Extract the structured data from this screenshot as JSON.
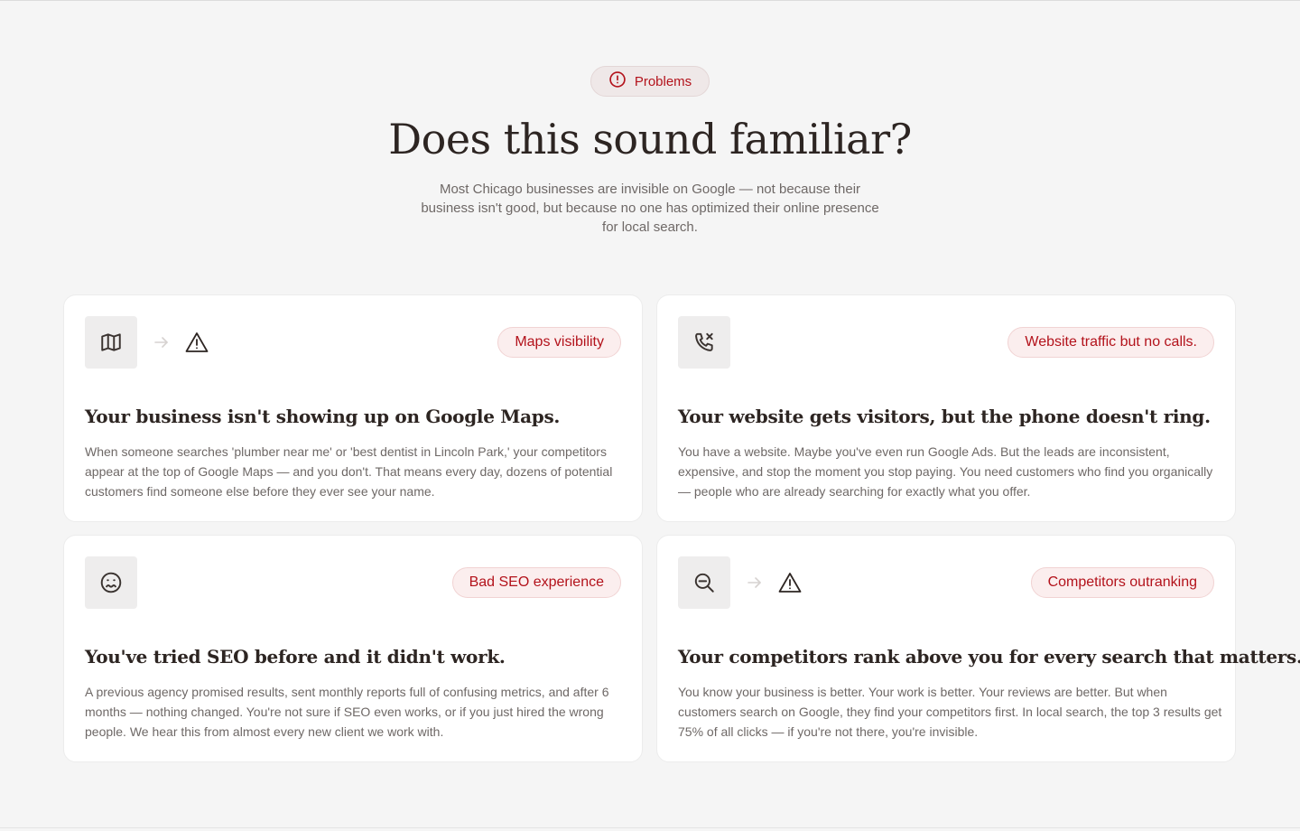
{
  "header": {
    "badge_label": "Problems",
    "badge_icon": "alert-circle-icon",
    "title": "Does this sound familiar?",
    "subtitle": "Most Chicago businesses are invisible on Google — not because their business isn't good, but because no one has optimized their online presence for local search."
  },
  "colors": {
    "accent": "#b3121b",
    "background": "#f5f5f5",
    "card": "#ffffff",
    "tag_background": "#fbeeee"
  },
  "cards": [
    {
      "icon": "map-icon",
      "tag": "Maps visibility",
      "title": "Your business isn't showing up on Google Maps.",
      "body": "When someone searches 'plumber near me' or 'best dentist in Lincoln Park,' your competitors appear at the top of Google Maps — and you don't. That means every day, dozens of potential customers find someone else before they ever see your name."
    },
    {
      "icon": "phone-missed-icon",
      "tag": "Website traffic but no calls.",
      "title": "Your website gets visitors, but the phone doesn't ring.",
      "body": "You have a website. Maybe you've even run Google Ads. But the leads are inconsistent, expensive, and stop the moment you stop paying. You need customers who find you organically — people who are already searching for exactly what you offer."
    },
    {
      "icon": "frown-face-icon",
      "tag": "Bad SEO experience",
      "title": "You've tried SEO before and it didn't work.",
      "body": "A previous agency promised results, sent monthly reports full of confusing metrics, and after 6 months — nothing changed. You're not sure if SEO even works, or if you just hired the wrong people. We hear this from almost every new client we work with."
    },
    {
      "icon": "zoom-out-icon",
      "tag": "Competitors outranking",
      "title": "Your competitors rank above you for every search that matters.",
      "body": "You know your business is better. Your work is better. Your reviews are better. But when customers search on Google, they find your competitors first. In local search, the top 3 results get 75% of all clicks — if you're not there, you're invisible."
    }
  ]
}
